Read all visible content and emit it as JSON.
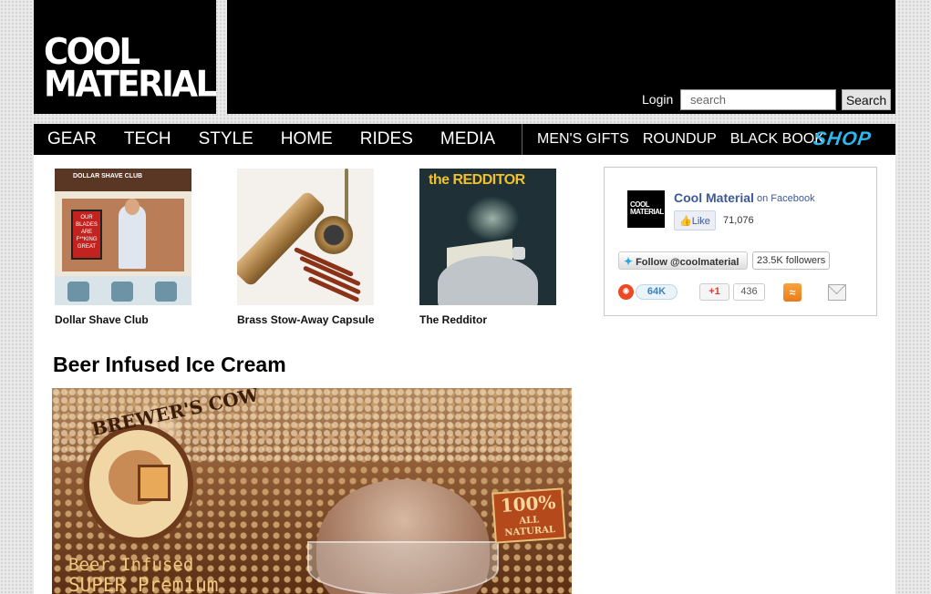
{
  "header": {
    "logo_line1": "COOL",
    "logo_line2": "MATERIAL",
    "login_label": "Login",
    "search_placeholder": "search",
    "search_button": "Search"
  },
  "nav": {
    "main": [
      "GEAR",
      "TECH",
      "STYLE",
      "HOME",
      "RIDES",
      "MEDIA"
    ],
    "secondary": [
      "MEN'S GIFTS",
      "ROUNDUP",
      "BLACK BOOK"
    ],
    "shop": "SHOP",
    "shop_color": "#2ab8f0"
  },
  "thumbs": [
    {
      "caption": "Dollar Shave Club",
      "image_text": "DOLLAR SHAVE CLUB",
      "sign_text": "OUR BLADES ARE F**KING GREAT"
    },
    {
      "caption": "Brass Stow-Away Capsule"
    },
    {
      "caption": "The Redditor",
      "image_text": "the REDDITOR"
    }
  ],
  "article": {
    "headline": "Beer Infused Ice Cream",
    "hero_brand": "BREWER'S COW",
    "hero_line1": "Beer Infused",
    "hero_line2": "SUPER Premium",
    "hero_seal_big": "100%",
    "hero_seal_small": "ALL NATURAL"
  },
  "social": {
    "fb_logo_line1": "COOL",
    "fb_logo_line2": "MATERIAL",
    "fb_page_name": "Cool Material",
    "fb_on": "on Facebook",
    "fb_like_label": "Like",
    "fb_like_count": "71,076",
    "tw_follow_label": "Follow @coolmaterial",
    "tw_followers": "23.5K followers",
    "stumble_count": "64K",
    "gplus_label": "+1",
    "gplus_count": "436"
  }
}
